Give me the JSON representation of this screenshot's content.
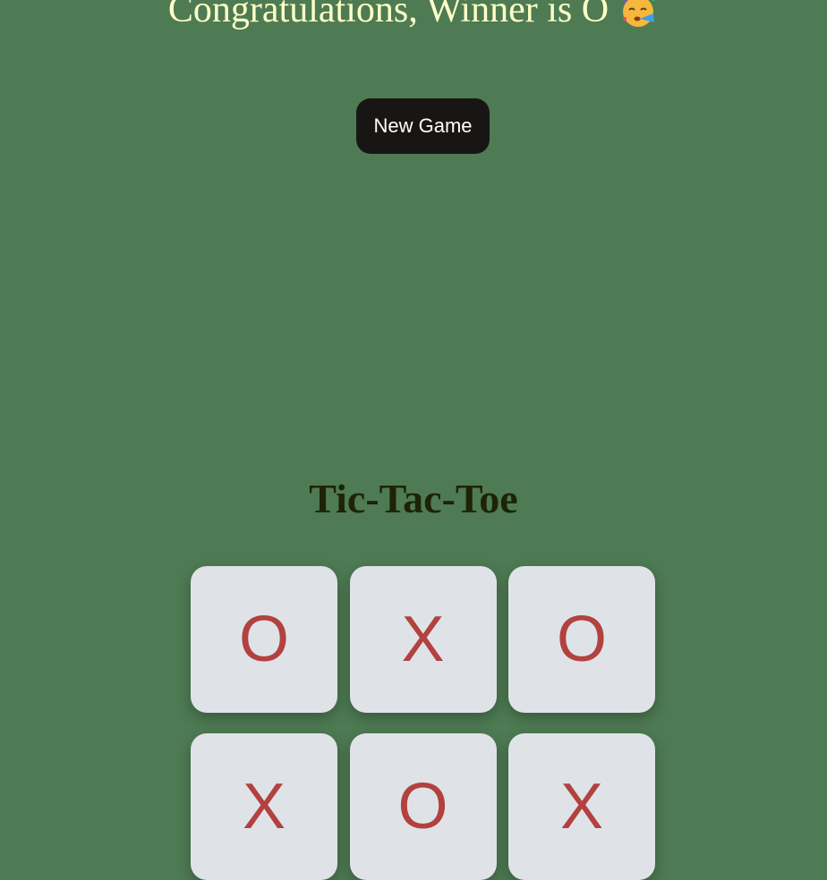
{
  "message": {
    "text": "Congratulations, Winner is O",
    "emoji_icon": "party-face-icon"
  },
  "controls": {
    "new_game_label": "New Game"
  },
  "title": "Tic-Tac-Toe",
  "board": {
    "cells": [
      "O",
      "X",
      "O",
      "X",
      "O",
      "X"
    ]
  },
  "colors": {
    "background": "#4e7b53",
    "message_text": "#ffffc7",
    "button_bg": "#181614",
    "title_text": "#1e2308",
    "cell_bg": "#dfe3e7",
    "mark": "#b2413f"
  }
}
